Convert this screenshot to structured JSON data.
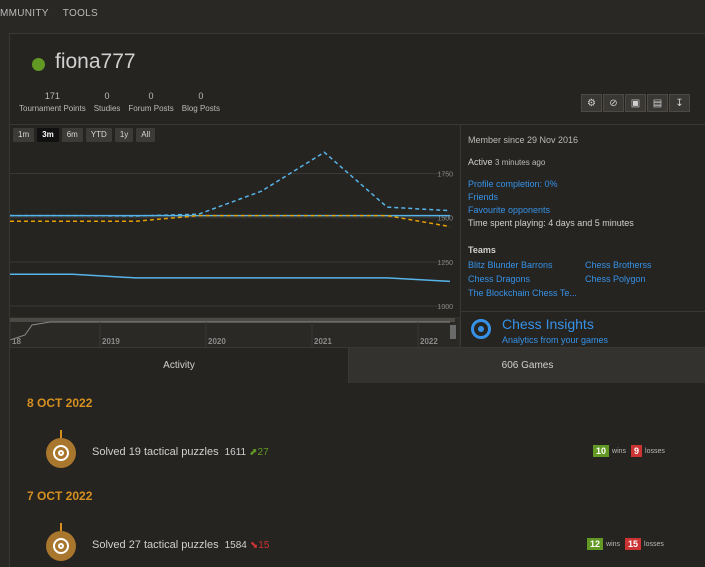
{
  "topnav": {
    "items": [
      "MMUNITY",
      "TOOLS"
    ]
  },
  "profile": {
    "username": "fiona777",
    "online_color": "#629924",
    "stats": [
      {
        "value": "171",
        "label": "Tournament Points"
      },
      {
        "value": "0",
        "label": "Studies"
      },
      {
        "value": "0",
        "label": "Forum Posts"
      },
      {
        "value": "0",
        "label": "Blog Posts"
      }
    ],
    "actions": [
      "gear-icon",
      "block-icon",
      "tv-icon",
      "book-icon",
      "download-icon"
    ]
  },
  "chart_data": {
    "type": "line",
    "range_buttons": [
      "1m",
      "3m",
      "6m",
      "YTD",
      "1y",
      "All"
    ],
    "active_range": "3m",
    "y_ticks": [
      "1750",
      "1500",
      "1250",
      "1000"
    ],
    "nav_x_labels": [
      "18",
      "2019",
      "2020",
      "2021",
      "2022"
    ],
    "series": [
      {
        "color": "#56b4e9",
        "style": "solid",
        "values": [
          1512,
          1512,
          1512,
          1512,
          1512,
          1512,
          1512,
          1512
        ]
      },
      {
        "color": "#e69f00",
        "style": "dashed",
        "values": [
          1480,
          1480,
          1480,
          1512,
          1512,
          1512,
          1512,
          1450
        ]
      },
      {
        "color": "#56b4e9",
        "style": "dashed",
        "values": [
          1512,
          1512,
          1510,
          1520,
          1650,
          1870,
          1560,
          1540
        ]
      },
      {
        "color": "#56b4e9",
        "style": "solid",
        "values": [
          1180,
          1180,
          1160,
          1160,
          1160,
          1160,
          1160,
          1140
        ]
      }
    ]
  },
  "side": {
    "member_since": "Member since 29 Nov 2016",
    "active_label": "Active",
    "active_time": "3 minutes ago",
    "profile_completion": "Profile completion: 0%",
    "friends": "Friends",
    "favourite_opponents": "Favourite opponents",
    "time_spent": "Time spent playing: 4 days and 5 minutes",
    "teams_title": "Teams",
    "teams": [
      "Blitz Blunder Barrons",
      "Chess Brotherss",
      "Chess Dragons",
      "Chess Polygon",
      "The Blockchain Chess Te..."
    ]
  },
  "insights": {
    "title": "Chess Insights",
    "subtitle": "Analytics from your games"
  },
  "tabs": {
    "activity": "Activity",
    "games": "606 Games"
  },
  "activity": [
    {
      "date": "8 OCT 2022",
      "text": "Solved 19 tactical puzzles",
      "rating": "1611",
      "change": "27",
      "direction": "up",
      "wins": "10",
      "wins_label": "wins",
      "losses": "9",
      "losses_label": "losses"
    },
    {
      "date": "7 OCT 2022",
      "text": "Solved 27 tactical puzzles",
      "rating": "1584",
      "change": "15",
      "direction": "down",
      "wins": "12",
      "wins_label": "wins",
      "losses": "15",
      "losses_label": "losses"
    }
  ]
}
